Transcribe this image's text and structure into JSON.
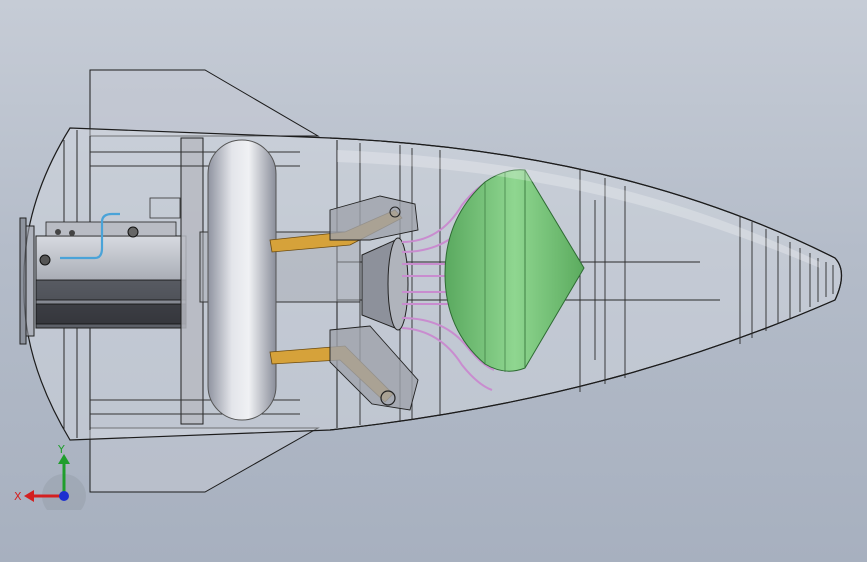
{
  "viewport": {
    "background_top": "#c6ccd6",
    "background_bottom": "#a7b0bf"
  },
  "model": {
    "parts": [
      "shroud-outline",
      "nose-cone",
      "fins",
      "cylinder-block",
      "mounting-disc",
      "torus-tank",
      "linkage-arms",
      "bell-housing",
      "green-dome",
      "pink-tubes",
      "blue-hose"
    ],
    "colors": {
      "shell": "#c9ced6",
      "outline": "#1c1c1c",
      "linkage": "#d6a23a",
      "dome": "#79c27b",
      "tubes": "#c98ccf",
      "hose": "#4aa3d8",
      "tank": "#c7c9d0"
    }
  },
  "triad": {
    "x_label": "X",
    "y_label": "Y",
    "x_color": "#d42020",
    "y_color": "#1f9e2c",
    "z_color": "#1d2fd0"
  }
}
